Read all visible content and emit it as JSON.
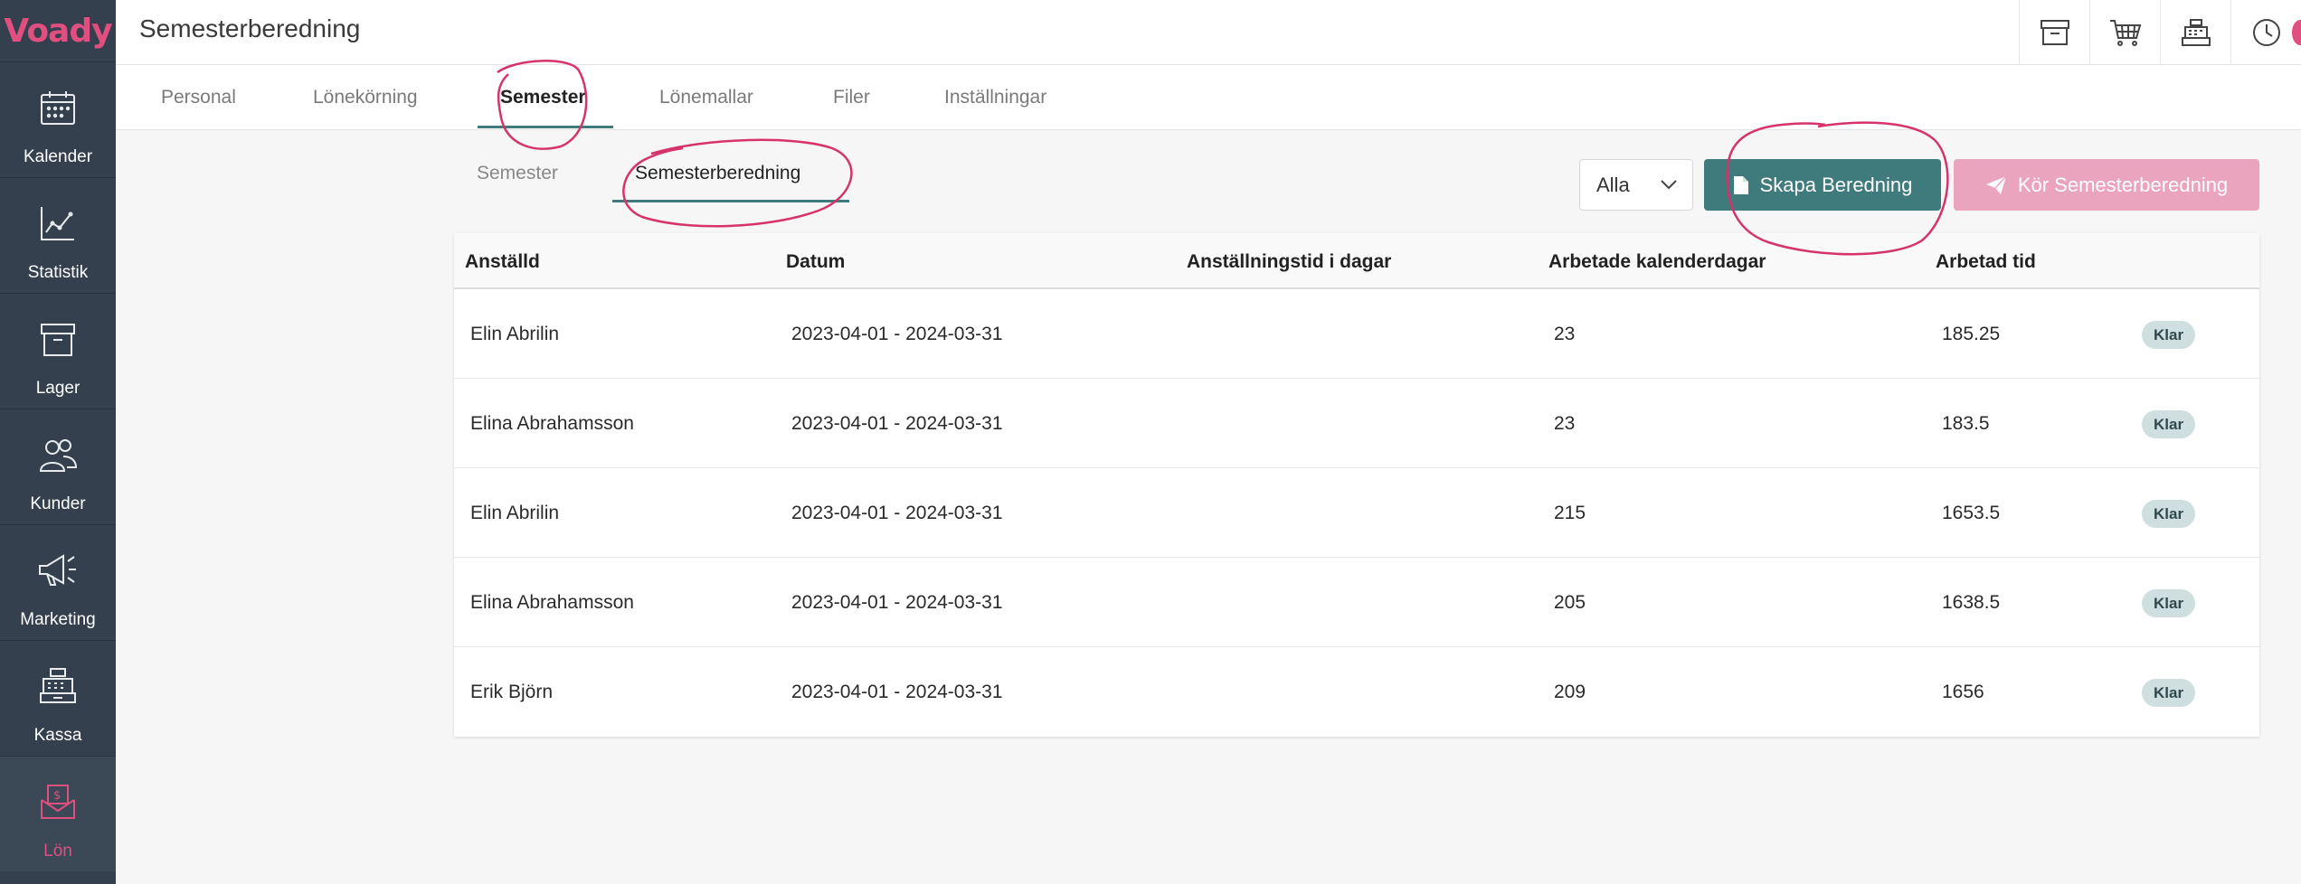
{
  "app": {
    "logo": "Voady"
  },
  "sidebar": {
    "items": [
      {
        "label": "Kalender",
        "icon": "calendar-icon"
      },
      {
        "label": "Statistik",
        "icon": "chart-icon"
      },
      {
        "label": "Lager",
        "icon": "archive-icon"
      },
      {
        "label": "Kunder",
        "icon": "users-icon"
      },
      {
        "label": "Marketing",
        "icon": "megaphone-icon"
      },
      {
        "label": "Kassa",
        "icon": "register-icon"
      },
      {
        "label": "Lön",
        "icon": "payroll-icon",
        "active": true
      }
    ]
  },
  "header": {
    "title": "Semesterberedning"
  },
  "tabs": [
    "Personal",
    "Lönekörning",
    "Semester",
    "Lönemallar",
    "Filer",
    "Inställningar"
  ],
  "active_tab": "Semester",
  "subtabs": [
    "Semester",
    "Semesterberedning"
  ],
  "active_subtab": "Semesterberedning",
  "filter": {
    "selected": "Alla"
  },
  "actions": {
    "create": "Skapa Beredning",
    "run": "Kör Semesterberedning"
  },
  "table": {
    "columns": [
      "Anställd",
      "Datum",
      "Anställningstid i dagar",
      "Arbetade kalenderdagar",
      "Arbetad tid"
    ],
    "rows": [
      {
        "employee": "Elin Abrilin",
        "date": "2023-04-01 - 2024-03-31",
        "days": "",
        "worked_days": "23",
        "worked_time": "185.25",
        "status": "Klar"
      },
      {
        "employee": "Elina Abrahamsson",
        "date": "2023-04-01 - 2024-03-31",
        "days": "",
        "worked_days": "23",
        "worked_time": "183.5",
        "status": "Klar"
      },
      {
        "employee": "Elin Abrilin",
        "date": "2023-04-01 - 2024-03-31",
        "days": "",
        "worked_days": "215",
        "worked_time": "1653.5",
        "status": "Klar"
      },
      {
        "employee": "Elina Abrahamsson",
        "date": "2023-04-01 - 2024-03-31",
        "days": "",
        "worked_days": "205",
        "worked_time": "1638.5",
        "status": "Klar"
      },
      {
        "employee": "Erik Björn",
        "date": "2023-04-01 - 2024-03-31",
        "days": "",
        "worked_days": "209",
        "worked_time": "1656",
        "status": "Klar"
      }
    ]
  },
  "colors": {
    "brand": "#e14e80",
    "accent": "#3f7a7d",
    "sidebar": "#34404d",
    "annotation": "#d6336c"
  }
}
